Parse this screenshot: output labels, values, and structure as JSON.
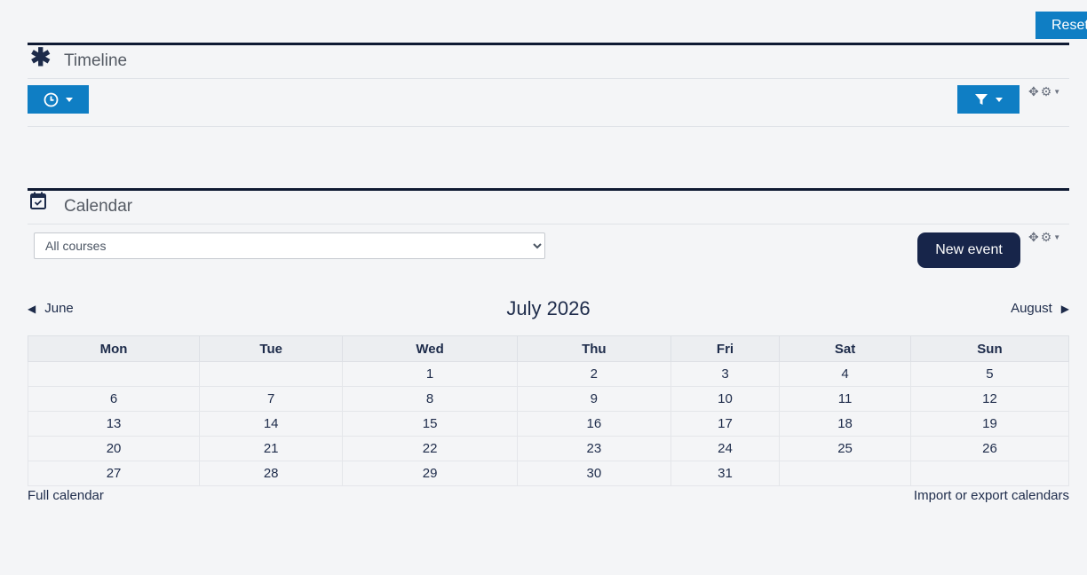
{
  "header": {
    "reset_label": "Reset"
  },
  "timeline": {
    "title": "Timeline",
    "icon": "asterisk-icon"
  },
  "calendar": {
    "title": "Calendar",
    "course_filter": {
      "selected": "All courses"
    },
    "new_event_label": "New event",
    "prev_month": "June",
    "current_month": "July 2026",
    "next_month": "August",
    "weekdays": [
      "Mon",
      "Tue",
      "Wed",
      "Thu",
      "Fri",
      "Sat",
      "Sun"
    ],
    "weeks": [
      [
        "",
        "",
        "1",
        "2",
        "3",
        "4",
        "5"
      ],
      [
        "6",
        "7",
        "8",
        "9",
        "10",
        "11",
        "12"
      ],
      [
        "13",
        "14",
        "15",
        "16",
        "17",
        "18",
        "19"
      ],
      [
        "20",
        "21",
        "22",
        "23",
        "24",
        "25",
        "26"
      ],
      [
        "27",
        "28",
        "29",
        "30",
        "31",
        "",
        ""
      ]
    ],
    "full_calendar_label": "Full calendar",
    "import_export_label": "Import or export calendars"
  },
  "colors": {
    "accent": "#0f7ec4",
    "dark_button": "#17254a",
    "background": "#f4f5f7"
  }
}
